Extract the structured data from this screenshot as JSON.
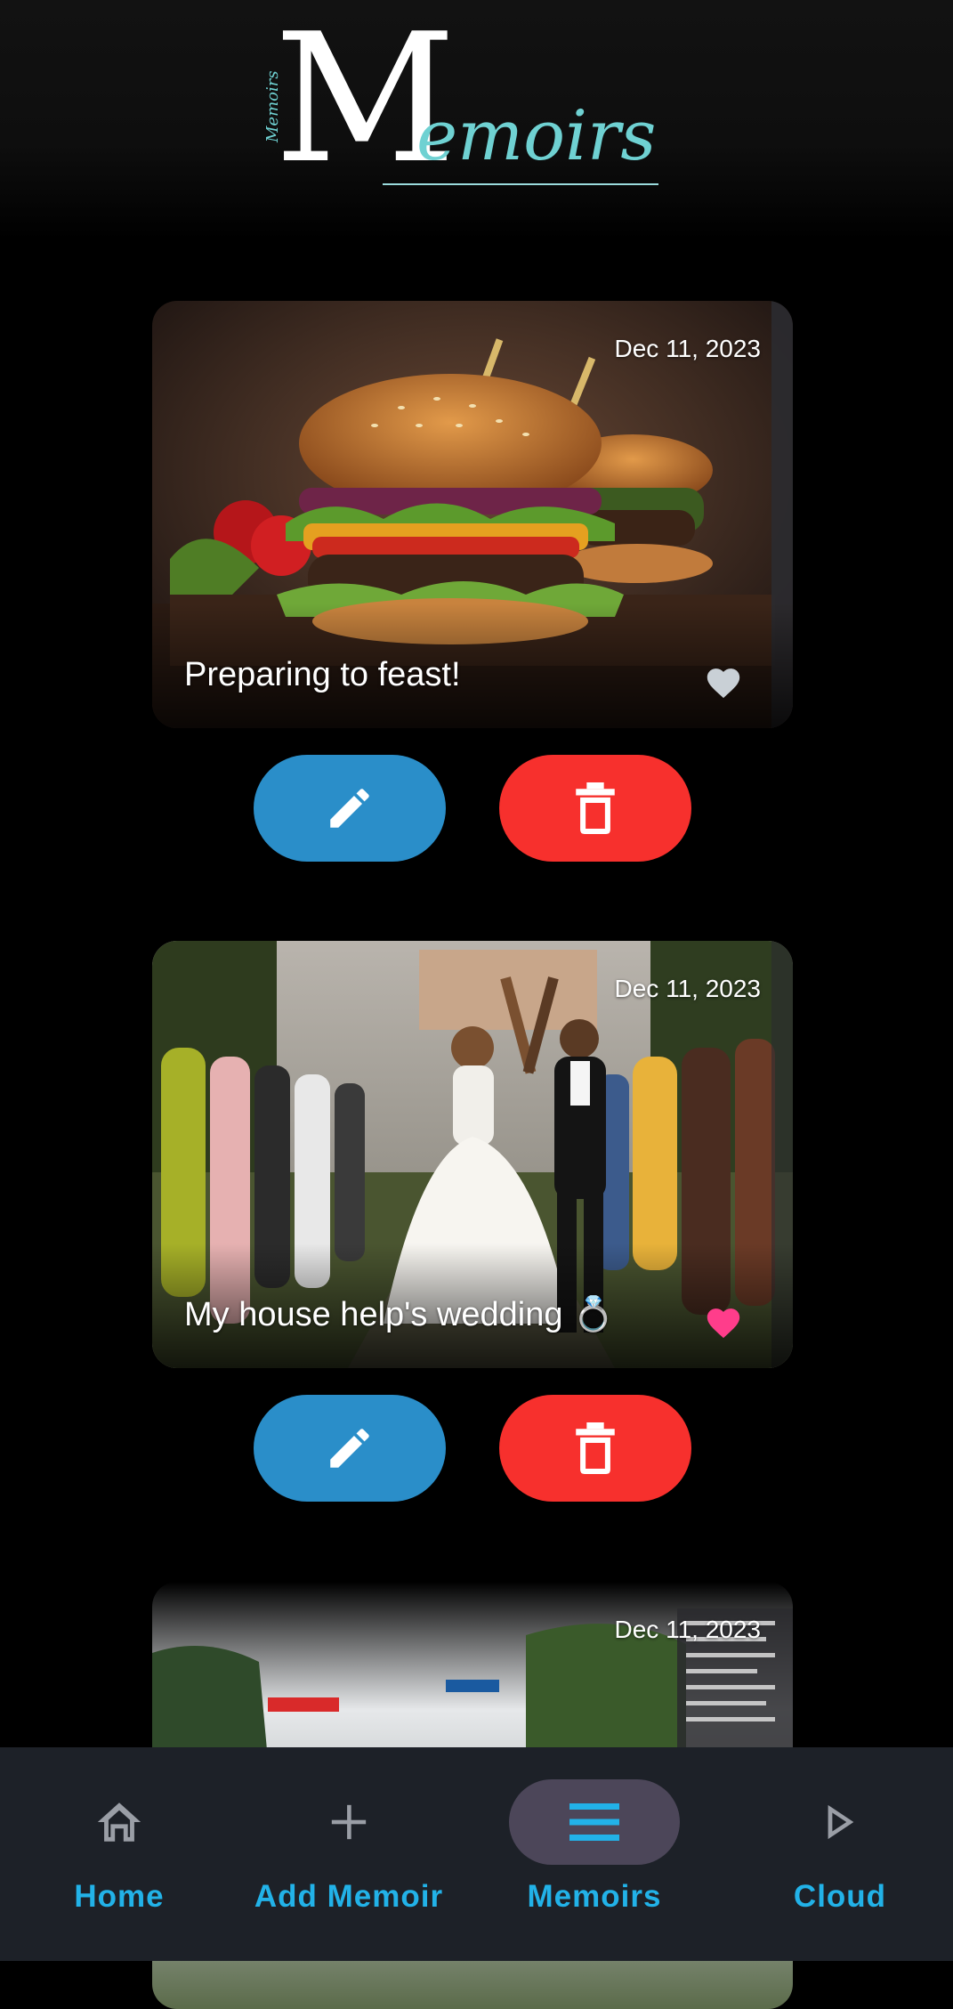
{
  "app": {
    "logo_initial": "M",
    "logo_rest": "emoirs",
    "logo_side_text": "Memoirs"
  },
  "colors": {
    "background": "#000000",
    "edit_button": "#2a8ec9",
    "delete_button": "#f7302d",
    "nav_bar": "#1d2128",
    "nav_label": "#22b2e8",
    "nav_active_pill": "#4c4659",
    "heart_inactive": "#c9d0d6",
    "heart_active": "#ff3d8b",
    "logo_accent": "#6fd1d2"
  },
  "memoirs": [
    {
      "date": "Dec 11, 2023",
      "caption": "Preparing to feast!",
      "favorite": false,
      "image": "burger-photo"
    },
    {
      "date": "Dec 11, 2023",
      "caption": "My house help's wedding 💍",
      "favorite": true,
      "image": "wedding-photo"
    },
    {
      "date": "Dec 11, 2023",
      "caption": "",
      "favorite": false,
      "image": "game-screenshot-photo"
    }
  ],
  "actions": {
    "edit_icon": "pencil-icon",
    "delete_icon": "trash-icon"
  },
  "nav": {
    "items": [
      {
        "label": "Home",
        "icon": "home-icon",
        "active": false
      },
      {
        "label": "Add Memoir",
        "icon": "plus-icon",
        "active": false
      },
      {
        "label": "Memoirs",
        "icon": "menu-icon",
        "active": true
      },
      {
        "label": "Cloud",
        "icon": "play-icon",
        "active": false
      }
    ]
  }
}
